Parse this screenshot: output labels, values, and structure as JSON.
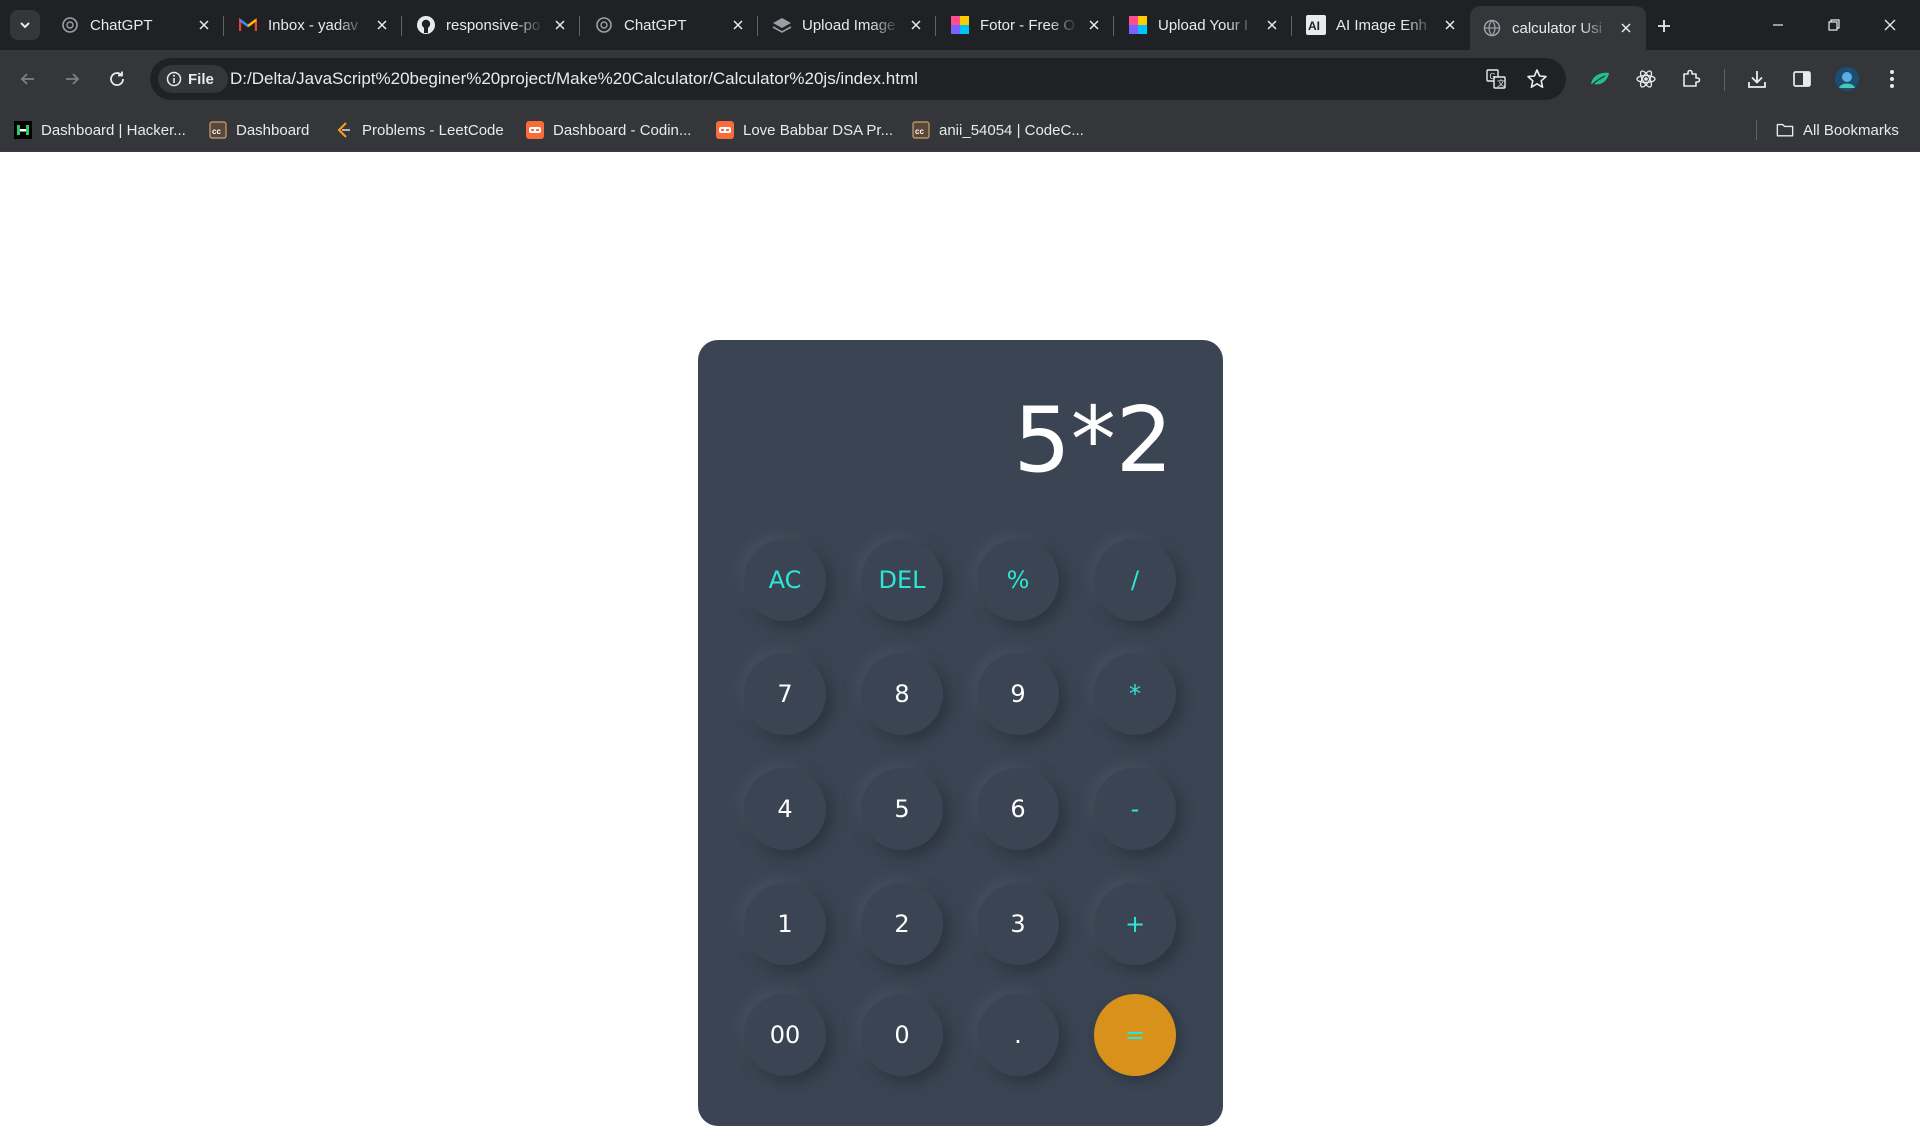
{
  "browser": {
    "tabs": [
      {
        "title": "ChatGPT",
        "icon": "chatgpt-icon"
      },
      {
        "title": "Inbox - yadav",
        "icon": "gmail-icon"
      },
      {
        "title": "responsive-po",
        "icon": "github-icon"
      },
      {
        "title": "ChatGPT",
        "icon": "chatgpt-icon"
      },
      {
        "title": "Upload Image",
        "icon": "layers-icon"
      },
      {
        "title": "Fotor - Free O",
        "icon": "fotor-icon"
      },
      {
        "title": "Upload Your I",
        "icon": "fotor-icon"
      },
      {
        "title": "AI Image Enh",
        "icon": "ai-logo-icon"
      },
      {
        "title": "calculator Usi",
        "icon": "globe-icon",
        "active": true
      }
    ],
    "address_bar": {
      "chip_label": "File",
      "url": "D:/Delta/JavaScript%20beginer%20project/Make%20Calculator/Calculator%20js/index.html"
    },
    "bookmarks": [
      {
        "label": "Dashboard | Hacker...",
        "icon": "hackerrank-icon"
      },
      {
        "label": "Dashboard",
        "icon": "codechef-icon"
      },
      {
        "label": "Problems - LeetCode",
        "icon": "leetcode-icon"
      },
      {
        "label": "Dashboard - Codin...",
        "icon": "codingninjas-icon"
      },
      {
        "label": "Love Babbar DSA Pr...",
        "icon": "codingninjas-icon"
      },
      {
        "label": "anii_54054 | CodeC...",
        "icon": "codechef-icon"
      }
    ],
    "all_bookmarks_label": "All Bookmarks"
  },
  "calculator": {
    "display": "5*2",
    "keys": [
      {
        "label": "AC",
        "type": "op"
      },
      {
        "label": "DEL",
        "type": "op"
      },
      {
        "label": "%",
        "type": "op"
      },
      {
        "label": "/",
        "type": "op"
      },
      {
        "label": "7",
        "type": "num"
      },
      {
        "label": "8",
        "type": "num"
      },
      {
        "label": "9",
        "type": "num"
      },
      {
        "label": "*",
        "type": "op"
      },
      {
        "label": "4",
        "type": "num"
      },
      {
        "label": "5",
        "type": "num"
      },
      {
        "label": "6",
        "type": "num"
      },
      {
        "label": "-",
        "type": "op"
      },
      {
        "label": "1",
        "type": "num"
      },
      {
        "label": "2",
        "type": "num"
      },
      {
        "label": "3",
        "type": "num"
      },
      {
        "label": "+",
        "type": "op"
      },
      {
        "label": "00",
        "type": "num"
      },
      {
        "label": "0",
        "type": "num"
      },
      {
        "label": ".",
        "type": "num"
      },
      {
        "label": "=",
        "type": "equals"
      }
    ],
    "colors": {
      "body": "#3a4452",
      "operator_text": "#2ee6d6",
      "number_text": "#ffffff",
      "equals_bg": "#d8921b"
    }
  }
}
